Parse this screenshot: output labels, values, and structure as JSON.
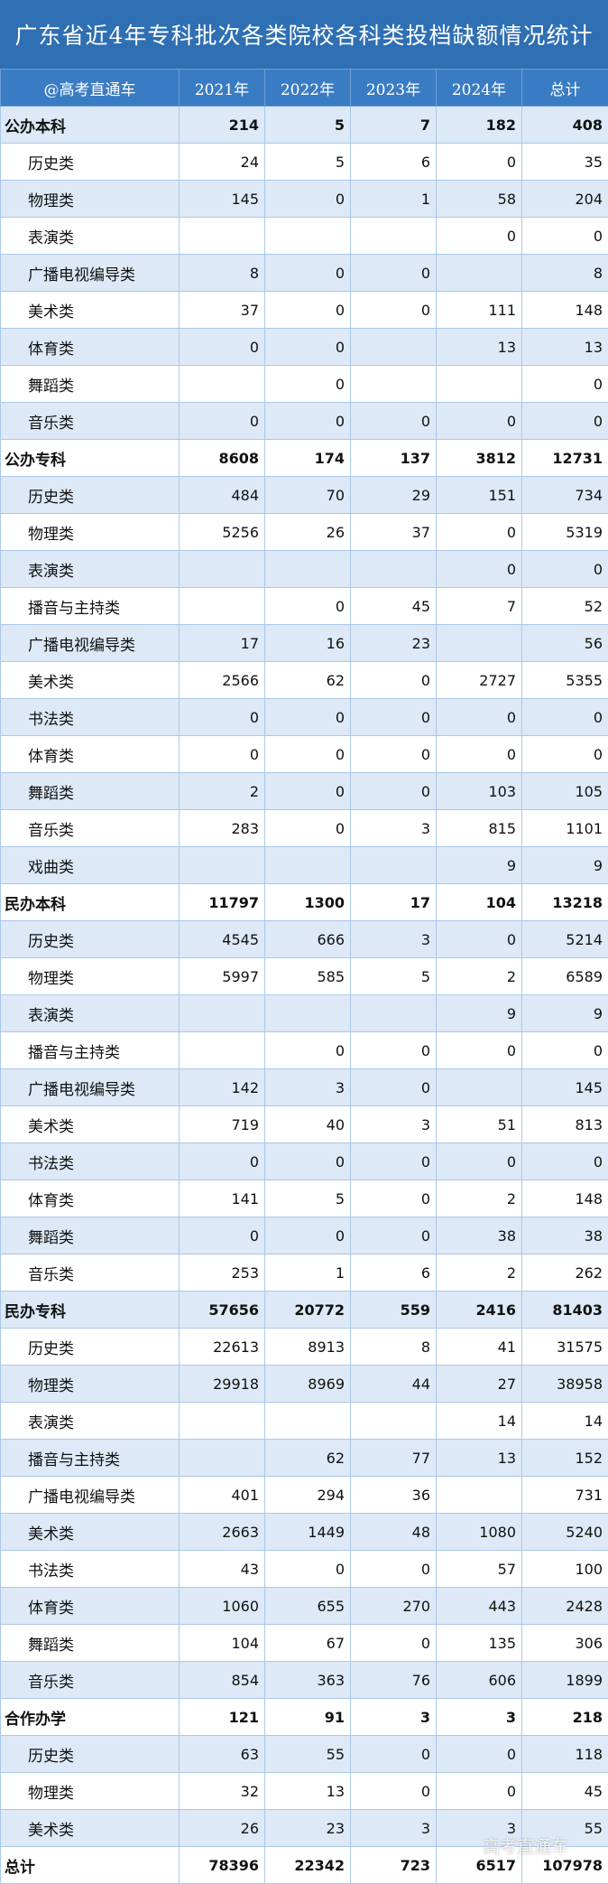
{
  "title": "广东省近4年专科批次各类院校各科类投档缺额情况统计",
  "header": [
    "@高考直通车",
    "2021年",
    "2022年",
    "2023年",
    "2024年",
    "总计"
  ],
  "watermark": "高考直通车",
  "rows": [
    {
      "type": "group",
      "name": "公办本科",
      "values": [
        "214",
        "5",
        "7",
        "182",
        "408"
      ]
    },
    {
      "type": "sub",
      "name": "历史类",
      "values": [
        "24",
        "5",
        "6",
        "0",
        "35"
      ]
    },
    {
      "type": "sub",
      "name": "物理类",
      "values": [
        "145",
        "0",
        "1",
        "58",
        "204"
      ]
    },
    {
      "type": "sub",
      "name": "表演类",
      "values": [
        "",
        "",
        "",
        "0",
        "0"
      ]
    },
    {
      "type": "sub",
      "name": "广播电视编导类",
      "values": [
        "8",
        "0",
        "0",
        "",
        "8"
      ]
    },
    {
      "type": "sub",
      "name": "美术类",
      "values": [
        "37",
        "0",
        "0",
        "111",
        "148"
      ]
    },
    {
      "type": "sub",
      "name": "体育类",
      "values": [
        "0",
        "0",
        "",
        "13",
        "13"
      ]
    },
    {
      "type": "sub",
      "name": "舞蹈类",
      "values": [
        "",
        "0",
        "",
        "",
        "0"
      ]
    },
    {
      "type": "sub",
      "name": "音乐类",
      "values": [
        "0",
        "0",
        "0",
        "0",
        "0"
      ]
    },
    {
      "type": "group",
      "name": "公办专科",
      "values": [
        "8608",
        "174",
        "137",
        "3812",
        "12731"
      ]
    },
    {
      "type": "sub",
      "name": "历史类",
      "values": [
        "484",
        "70",
        "29",
        "151",
        "734"
      ]
    },
    {
      "type": "sub",
      "name": "物理类",
      "values": [
        "5256",
        "26",
        "37",
        "0",
        "5319"
      ]
    },
    {
      "type": "sub",
      "name": "表演类",
      "values": [
        "",
        "",
        "",
        "0",
        "0"
      ]
    },
    {
      "type": "sub",
      "name": "播音与主持类",
      "values": [
        "",
        "0",
        "45",
        "7",
        "52"
      ]
    },
    {
      "type": "sub",
      "name": "广播电视编导类",
      "values": [
        "17",
        "16",
        "23",
        "",
        "56"
      ]
    },
    {
      "type": "sub",
      "name": "美术类",
      "values": [
        "2566",
        "62",
        "0",
        "2727",
        "5355"
      ]
    },
    {
      "type": "sub",
      "name": "书法类",
      "values": [
        "0",
        "0",
        "0",
        "0",
        "0"
      ]
    },
    {
      "type": "sub",
      "name": "体育类",
      "values": [
        "0",
        "0",
        "0",
        "0",
        "0"
      ]
    },
    {
      "type": "sub",
      "name": "舞蹈类",
      "values": [
        "2",
        "0",
        "0",
        "103",
        "105"
      ]
    },
    {
      "type": "sub",
      "name": "音乐类",
      "values": [
        "283",
        "0",
        "3",
        "815",
        "1101"
      ]
    },
    {
      "type": "sub",
      "name": "戏曲类",
      "values": [
        "",
        "",
        "",
        "9",
        "9"
      ]
    },
    {
      "type": "group",
      "name": "民办本科",
      "values": [
        "11797",
        "1300",
        "17",
        "104",
        "13218"
      ]
    },
    {
      "type": "sub",
      "name": "历史类",
      "values": [
        "4545",
        "666",
        "3",
        "0",
        "5214"
      ]
    },
    {
      "type": "sub",
      "name": "物理类",
      "values": [
        "5997",
        "585",
        "5",
        "2",
        "6589"
      ]
    },
    {
      "type": "sub",
      "name": "表演类",
      "values": [
        "",
        "",
        "",
        "9",
        "9"
      ]
    },
    {
      "type": "sub",
      "name": "播音与主持类",
      "values": [
        "",
        "0",
        "0",
        "0",
        "0"
      ]
    },
    {
      "type": "sub",
      "name": "广播电视编导类",
      "values": [
        "142",
        "3",
        "0",
        "",
        "145"
      ]
    },
    {
      "type": "sub",
      "name": "美术类",
      "values": [
        "719",
        "40",
        "3",
        "51",
        "813"
      ]
    },
    {
      "type": "sub",
      "name": "书法类",
      "values": [
        "0",
        "0",
        "0",
        "0",
        "0"
      ]
    },
    {
      "type": "sub",
      "name": "体育类",
      "values": [
        "141",
        "5",
        "0",
        "2",
        "148"
      ]
    },
    {
      "type": "sub",
      "name": "舞蹈类",
      "values": [
        "0",
        "0",
        "0",
        "38",
        "38"
      ]
    },
    {
      "type": "sub",
      "name": "音乐类",
      "values": [
        "253",
        "1",
        "6",
        "2",
        "262"
      ]
    },
    {
      "type": "group",
      "name": "民办专科",
      "values": [
        "57656",
        "20772",
        "559",
        "2416",
        "81403"
      ]
    },
    {
      "type": "sub",
      "name": "历史类",
      "values": [
        "22613",
        "8913",
        "8",
        "41",
        "31575"
      ]
    },
    {
      "type": "sub",
      "name": "物理类",
      "values": [
        "29918",
        "8969",
        "44",
        "27",
        "38958"
      ]
    },
    {
      "type": "sub",
      "name": "表演类",
      "values": [
        "",
        "",
        "",
        "14",
        "14"
      ]
    },
    {
      "type": "sub",
      "name": "播音与主持类",
      "values": [
        "",
        "62",
        "77",
        "13",
        "152"
      ]
    },
    {
      "type": "sub",
      "name": "广播电视编导类",
      "values": [
        "401",
        "294",
        "36",
        "",
        "731"
      ]
    },
    {
      "type": "sub",
      "name": "美术类",
      "values": [
        "2663",
        "1449",
        "48",
        "1080",
        "5240"
      ]
    },
    {
      "type": "sub",
      "name": "书法类",
      "values": [
        "43",
        "0",
        "0",
        "57",
        "100"
      ]
    },
    {
      "type": "sub",
      "name": "体育类",
      "values": [
        "1060",
        "655",
        "270",
        "443",
        "2428"
      ]
    },
    {
      "type": "sub",
      "name": "舞蹈类",
      "values": [
        "104",
        "67",
        "0",
        "135",
        "306"
      ]
    },
    {
      "type": "sub",
      "name": "音乐类",
      "values": [
        "854",
        "363",
        "76",
        "606",
        "1899"
      ]
    },
    {
      "type": "group",
      "name": "合作办学",
      "values": [
        "121",
        "91",
        "3",
        "3",
        "218"
      ]
    },
    {
      "type": "sub",
      "name": "历史类",
      "values": [
        "63",
        "55",
        "0",
        "0",
        "118"
      ]
    },
    {
      "type": "sub",
      "name": "物理类",
      "values": [
        "32",
        "13",
        "0",
        "0",
        "45"
      ]
    },
    {
      "type": "sub",
      "name": "美术类",
      "values": [
        "26",
        "23",
        "3",
        "3",
        "55"
      ]
    },
    {
      "type": "group",
      "name": "总计",
      "values": [
        "78396",
        "22342",
        "723",
        "6517",
        "107978"
      ]
    }
  ]
}
